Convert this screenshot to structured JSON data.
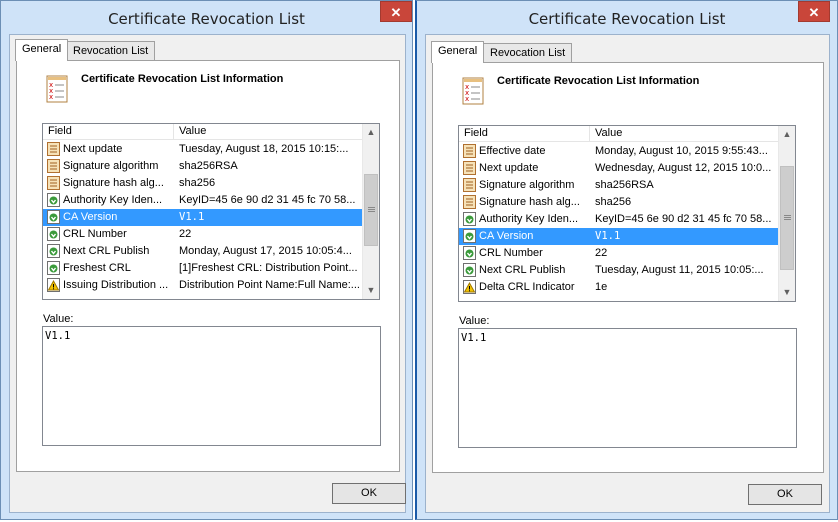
{
  "windows": [
    {
      "title": "Certificate Revocation List",
      "tabs": [
        "General",
        "Revocation List"
      ],
      "heading": "Certificate Revocation List Information",
      "columns": [
        "Field",
        "Value"
      ],
      "rows": [
        {
          "icon": "document",
          "field": "Next update",
          "value": "Tuesday, August 18, 2015 10:15:..."
        },
        {
          "icon": "document",
          "field": "Signature algorithm",
          "value": "sha256RSA"
        },
        {
          "icon": "document",
          "field": "Signature hash alg...",
          "value": "sha256"
        },
        {
          "icon": "extension",
          "field": "Authority Key Iden...",
          "value": "KeyID=45 6e 90 d2 31 45 fc 70 58..."
        },
        {
          "icon": "extension",
          "field": "CA Version",
          "value": "V1.1",
          "selected": true
        },
        {
          "icon": "extension",
          "field": "CRL Number",
          "value": "22"
        },
        {
          "icon": "extension",
          "field": "Next CRL Publish",
          "value": "Monday, August 17, 2015 10:05:4..."
        },
        {
          "icon": "extension",
          "field": "Freshest CRL",
          "value": "[1]Freshest CRL: Distribution Point..."
        },
        {
          "icon": "warning",
          "field": "Issuing Distribution ...",
          "value": "Distribution Point Name:Full Name:..."
        }
      ],
      "value_label": "Value:",
      "value_text": "V1.1",
      "ok_label": "OK",
      "scroll_fraction": 0.5
    },
    {
      "title": "Certificate Revocation List",
      "tabs": [
        "General",
        "Revocation List"
      ],
      "heading": "Certificate Revocation List Information",
      "columns": [
        "Field",
        "Value"
      ],
      "rows": [
        {
          "icon": "document",
          "field": "Effective date",
          "value": "Monday, August 10, 2015 9:55:43..."
        },
        {
          "icon": "document",
          "field": "Next update",
          "value": "Wednesday, August 12, 2015 10:0..."
        },
        {
          "icon": "document",
          "field": "Signature algorithm",
          "value": "sha256RSA"
        },
        {
          "icon": "document",
          "field": "Signature hash alg...",
          "value": "sha256"
        },
        {
          "icon": "extension",
          "field": "Authority Key Iden...",
          "value": "KeyID=45 6e 90 d2 31 45 fc 70 58..."
        },
        {
          "icon": "extension",
          "field": "CA Version",
          "value": "V1.1",
          "selected": true
        },
        {
          "icon": "extension",
          "field": "CRL Number",
          "value": "22"
        },
        {
          "icon": "extension",
          "field": "Next CRL Publish",
          "value": "Tuesday, August 11, 2015 10:05:..."
        },
        {
          "icon": "warning",
          "field": "Delta CRL Indicator",
          "value": "1e"
        }
      ],
      "value_label": "Value:",
      "value_text": "V1.1",
      "ok_label": "OK",
      "scroll_fraction": 0.4
    }
  ],
  "colors": {
    "title_bar": "#cfe3f8",
    "close_button": "#c9463a",
    "selection": "#3399ff",
    "active_border": "#1a5aa8"
  },
  "icons": {
    "close": "close-x-icon",
    "info": "certificate-list-icon",
    "document": "document-field-icon",
    "extension": "extension-field-icon",
    "warning": "critical-extension-icon",
    "scroll_up": "chevron-up-icon",
    "scroll_down": "chevron-down-icon"
  }
}
